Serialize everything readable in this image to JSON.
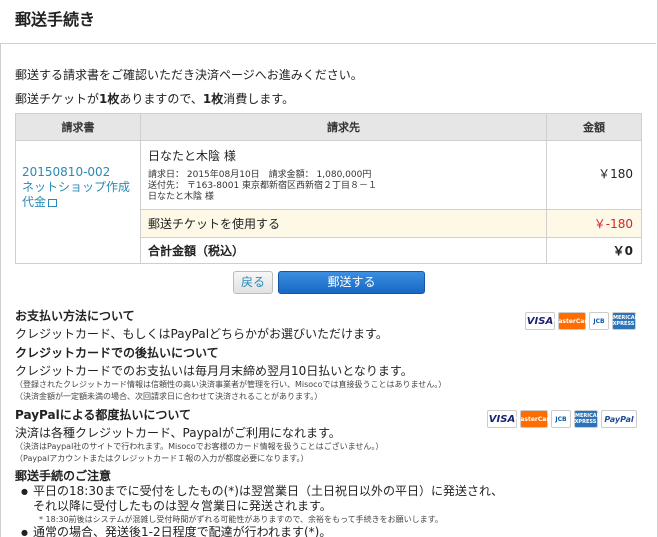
{
  "page": {
    "title": "郵送手続き"
  },
  "intro": {
    "line1": "郵送する請求書をご確認いただき決済ページへお進みください。",
    "line2_a": "郵送チケットが",
    "line2_b": "1枚",
    "line2_c": "ありますので、",
    "line2_d": "1枚",
    "line2_e": "消費します。"
  },
  "table": {
    "headers": [
      "請求書",
      "請求先",
      "金額"
    ],
    "invoice": {
      "number": "20150810-002",
      "title": "ネットショップ作成代金"
    },
    "recipient": {
      "name": "日なたと木陰 様",
      "line1": "請求日： 2015年08月10日　請求金額： 1,080,000円",
      "line2": "送付先： 〒163-8001 東京都新宿区西新宿２丁目８－１",
      "line3": "日なたと木陰 様"
    },
    "amount": "￥180",
    "ticket_label": "郵送チケットを使用する",
    "ticket_amount": "￥-180",
    "total_label": "合計金額（税込）",
    "total_amount": "￥0"
  },
  "buttons": {
    "back": "戻る",
    "send": "郵送する"
  },
  "payment": {
    "title": "お支払い方法について",
    "desc": "クレジットカード、もしくはPayPalどちらかがお選びいただけます。"
  },
  "credit": {
    "title": "クレジットカードでの後払いについて",
    "desc": "クレジットカードでのお支払いは毎月月末締め翌月10日払いとなります。",
    "note1": "（登録されたクレジットカード情報は信頼性の高い決済事業者が管理を行い、Misocoでは直接扱うことはありません。）",
    "note2": "（決済金額が一定額未満の場合、次回請求日に合わせて決済されることがあります。）"
  },
  "paypal": {
    "title": "PayPalによる都度払いについて",
    "desc": "決済は各種クレジットカード、Paypalがご利用になれます。",
    "note1": "（決済はPaypal社のサイトで行われます。Misocoでお客様のカード情報を扱うことはございません。）",
    "note2": "（PaypalアカウントまたはクレジットカードＩ報の入力が都度必要になります。）"
  },
  "notice": {
    "title": "郵送手続のご注意",
    "item1": "平日の18:30までに受付をしたもの(*)は翌営業日（土日祝日以外の平日）に発送され、",
    "item1b": "それ以降に受付したものは翌々営業日に発送されます。",
    "item1_note": "* 18:30前後はシステムが混雑し受付時間がずれる可能性がありますので、余裕をもって手続きをお願いします。",
    "item2": "通常の場合、発送後1-2日程度で配達が行われます(*)。"
  },
  "brands": {
    "visa": "VISA",
    "mastercard": "MasterCard",
    "jcb": "JCB",
    "amex": "AMERICAN EXPRESS",
    "paypal": "PayPal"
  }
}
